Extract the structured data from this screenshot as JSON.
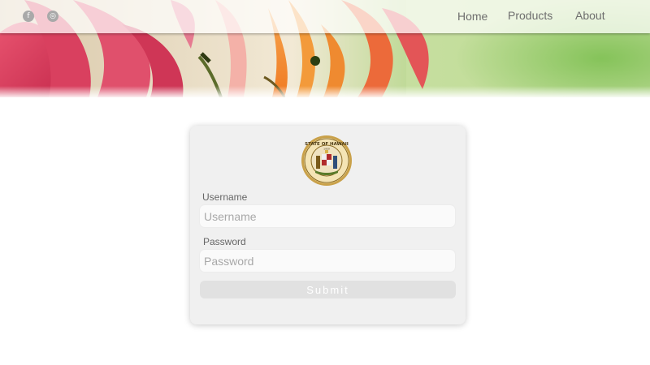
{
  "nav": {
    "social": [
      {
        "icon": "facebook-icon",
        "glyph": "f"
      },
      {
        "icon": "instagram-icon",
        "glyph": "◎"
      }
    ],
    "links": [
      "Home",
      "Products",
      "About"
    ]
  },
  "login": {
    "seal_icon": "hawaii-state-seal",
    "seal_text": "STATE OF HAWAII",
    "seal_year": "1959",
    "username_label": "Username",
    "username_placeholder": "Username",
    "username_value": "",
    "password_label": "Password",
    "password_placeholder": "Password",
    "password_value": "",
    "submit_label": "Submit"
  },
  "colors": {
    "card_bg": "#f0f0f0",
    "submit_bg": "#e1e1e1",
    "nav_text": "#6e6e6e"
  }
}
